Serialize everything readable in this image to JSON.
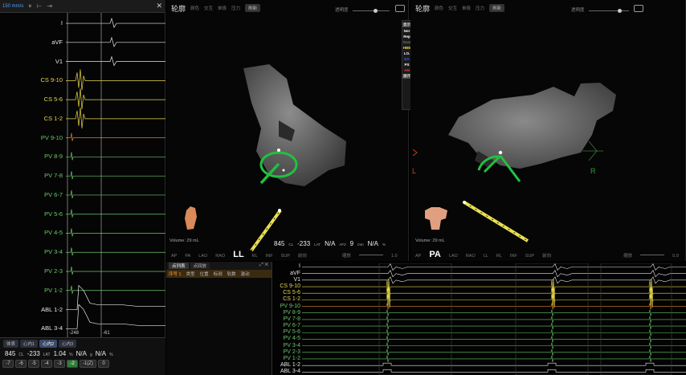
{
  "egm_panel": {
    "speed": "150 mm/s",
    "toolbar_icons": [
      "pause-icon",
      "caliper-icon",
      "arrow-icon"
    ],
    "close": "✕",
    "channels": [
      {
        "label": "I",
        "color": "white"
      },
      {
        "label": "aVF",
        "color": "white"
      },
      {
        "label": "V1",
        "color": "white"
      },
      {
        "label": "CS 9-10",
        "color": "yellow"
      },
      {
        "label": "CS 5-6",
        "color": "yellow"
      },
      {
        "label": "CS 1-2",
        "color": "yellow"
      },
      {
        "label": "PV 9-10",
        "color": "green"
      },
      {
        "label": "PV 8-9",
        "color": "green"
      },
      {
        "label": "PV 7-8",
        "color": "green"
      },
      {
        "label": "PV 6-7",
        "color": "green"
      },
      {
        "label": "PV 5-6",
        "color": "green"
      },
      {
        "label": "PV 4-5",
        "color": "green"
      },
      {
        "label": "PV 3-4",
        "color": "green"
      },
      {
        "label": "PV 2-3",
        "color": "green"
      },
      {
        "label": "PV 1-2",
        "color": "green"
      },
      {
        "label": "ABL 1-2",
        "color": "white"
      },
      {
        "label": "ABL 3-4",
        "color": "white"
      }
    ],
    "caliper_left": "-248",
    "caliper_right": "-61",
    "tabs": [
      "体表",
      "心内1",
      "心内2",
      "心内3"
    ],
    "readout": {
      "cl": "845",
      "cl_unit": "CL",
      "lat": "-233",
      "lat_unit": "LAT",
      "ratio": "1.04",
      "ratio_unit": "%",
      "na1": "N/A",
      "na1_unit": "g",
      "na2": "N/A",
      "na2_unit": "%"
    },
    "num_buttons": [
      "-7",
      "-6",
      "-5",
      "-4",
      "-3",
      "-2",
      "-1(Z)",
      "0"
    ]
  },
  "map_left": {
    "title": "轮廓",
    "tools": [
      "颜色",
      "交互",
      "单极",
      "压力"
    ],
    "tool_button": "刷新",
    "transparency": "透明度",
    "volume": "Volume: 29 mL",
    "views": [
      "AP",
      "PA",
      "LAO",
      "RAO",
      "LL",
      "RL",
      "INF",
      "SUP",
      "前向"
    ],
    "active_view": "LL",
    "readout": {
      "cl": "845",
      "cl_unit": "CL",
      "lat": "-233",
      "lat_unit": "LAT",
      "na": "N/A",
      "na_unit": "AF2",
      "mm": "9",
      "mm_unit": "mm",
      "na2": "N/A",
      "na2_unit": "%"
    },
    "scale_label": "缩放",
    "scale_value": "1.0"
  },
  "map_right": {
    "title": "轮廓",
    "tools": [
      "颜色",
      "交互",
      "单极",
      "压力"
    ],
    "tool_button": "刷新",
    "transparency": "透明度",
    "volume": "Volume: 29 mL",
    "views": [
      "AP",
      "PA",
      "LAO",
      "RAO",
      "LL",
      "RL",
      "INF",
      "SUP",
      "前向"
    ],
    "active_view": "PA",
    "side_left": "L",
    "side_right": "R",
    "scale_label": "缩放",
    "scale_value": "0.9"
  },
  "legend": {
    "top_button": "显示",
    "items": [
      {
        "label": "Nor",
        "color": "#ffffff"
      },
      {
        "label": "Rep",
        "color": "#ffffff"
      },
      {
        "label": "Scar",
        "color": "#777777"
      },
      {
        "label": "HBE",
        "color": "#f0d030"
      },
      {
        "label": "LO.",
        "color": "#ffffff"
      },
      {
        "label": "DA",
        "color": "#3060ff"
      },
      {
        "label": "PS",
        "color": "#ffffff"
      },
      {
        "label": "AM",
        "color": "#ff3030"
      }
    ],
    "bottom_button": "展开"
  },
  "list_panel": {
    "tabs": [
      "点列表",
      "点回放"
    ],
    "header": [
      "序号 1",
      "类型",
      "位置",
      "标测",
      "轨数",
      "激动"
    ]
  },
  "strip": {
    "channels": [
      {
        "label": "I",
        "color": "white"
      },
      {
        "label": "aVF",
        "color": "white"
      },
      {
        "label": "V1",
        "color": "white"
      },
      {
        "label": "CS 9-10",
        "color": "yellow"
      },
      {
        "label": "CS 5-6",
        "color": "yellow"
      },
      {
        "label": "CS 1-2",
        "color": "yellow"
      },
      {
        "label": "PV 9-10",
        "color": "green"
      },
      {
        "label": "PV 8-9",
        "color": "green"
      },
      {
        "label": "PV 7-8",
        "color": "green"
      },
      {
        "label": "PV 6-7",
        "color": "green"
      },
      {
        "label": "PV 5-6",
        "color": "green"
      },
      {
        "label": "PV 4-5",
        "color": "green"
      },
      {
        "label": "PV 3-4",
        "color": "green"
      },
      {
        "label": "PV 2-3",
        "color": "green"
      },
      {
        "label": "PV 1-2",
        "color": "green"
      },
      {
        "label": "ABL 1-2",
        "color": "white"
      },
      {
        "label": "ABL 3-4",
        "color": "white"
      }
    ]
  },
  "colors": {
    "egm_white": "#e8e8e8",
    "egm_yellow": "#e6d84a",
    "egm_green": "#6cc86c",
    "egm_orange": "#e08030",
    "catheter_green": "#22c040",
    "catheter_yellow": "#e8e050"
  }
}
